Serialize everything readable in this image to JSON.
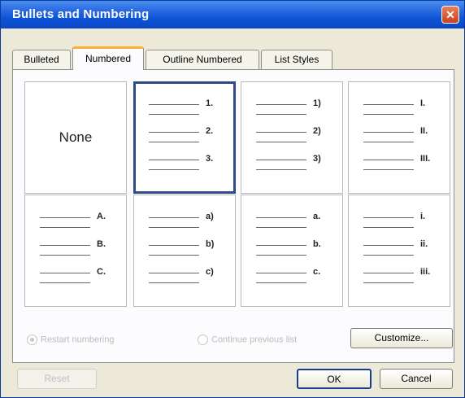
{
  "window": {
    "title": "Bullets and Numbering",
    "close_glyph": "✕"
  },
  "tabs": [
    {
      "label": "Bulleted",
      "active": false
    },
    {
      "label": "Numbered",
      "active": true
    },
    {
      "label": "Outline Numbered",
      "active": false
    },
    {
      "label": "List Styles",
      "active": false
    }
  ],
  "gallery": {
    "none_label": "None",
    "styles": [
      {
        "marks": [
          "1.",
          "2.",
          "3."
        ]
      },
      {
        "marks": [
          "1)",
          "2)",
          "3)"
        ]
      },
      {
        "marks": [
          "I.",
          "II.",
          "III."
        ]
      },
      {
        "marks": [
          "A.",
          "B.",
          "C."
        ]
      },
      {
        "marks": [
          "a)",
          "b)",
          "c)"
        ]
      },
      {
        "marks": [
          "a.",
          "b.",
          "c."
        ]
      },
      {
        "marks": [
          "i.",
          "ii.",
          "iii."
        ]
      }
    ]
  },
  "options": {
    "restart": "Restart numbering",
    "continue": "Continue previous list"
  },
  "buttons": {
    "customize": "Customize...",
    "reset": "Reset",
    "ok": "OK",
    "cancel": "Cancel"
  }
}
